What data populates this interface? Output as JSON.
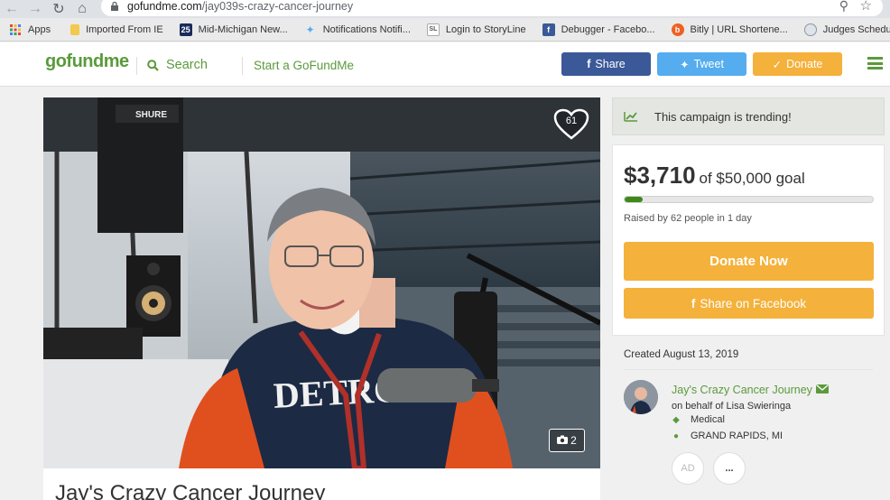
{
  "browser": {
    "url_host": "gofundme.com",
    "url_path": "/jay039s-crazy-cancer-journey",
    "bookmarks": [
      {
        "label": "Apps",
        "icon": "apps-grid-icon",
        "color": "#e8453c"
      },
      {
        "label": "Imported From IE",
        "icon": "folder-icon",
        "color": "#f2c94c"
      },
      {
        "label": "Mid-Michigan New...",
        "icon": "channel-25-icon",
        "color": "#1a2b5c"
      },
      {
        "label": "Notifications Notifi...",
        "icon": "twitter-bird-icon",
        "color": "#55acee"
      },
      {
        "label": "Login to StoryLine",
        "icon": "storyline-icon",
        "color": "#777777"
      },
      {
        "label": "Debugger - Facebo...",
        "icon": "facebook-icon",
        "color": "#3b5998"
      },
      {
        "label": "Bitly | URL Shortene...",
        "icon": "bitly-icon",
        "color": "#ee6123"
      },
      {
        "label": "Judges Schedule –...",
        "icon": "globe-icon",
        "color": "#8b95a5"
      }
    ]
  },
  "header": {
    "logo": "gofundme",
    "search_label": "Search",
    "start_label": "Start a GoFundMe",
    "share_label": "Share",
    "tweet_label": "Tweet",
    "donate_label": "Donate",
    "colors": {
      "brand": "#5b9a3c",
      "facebook": "#3b5998",
      "twitter": "#55acee",
      "donate": "#f4b13b"
    }
  },
  "campaign": {
    "title": "Jay's Crazy Cancer Journey",
    "hearts": "61",
    "photo_count": "2",
    "photo_text": "DETROIT"
  },
  "sidebar": {
    "trending_text": "This campaign is trending!",
    "amount_raised": "$3,710",
    "goal_text": "of $50,000 goal",
    "progress_fraction": 0.0742,
    "raised_by": "Raised by 62 people in 1 day",
    "donate_now_label": "Donate Now",
    "share_facebook_label": "Share on Facebook",
    "created": "Created August 13, 2019",
    "organizer_name": "Jay's Crazy Cancer Journey",
    "on_behalf": "on behalf of Lisa Swieringa",
    "category": "Medical",
    "location": "GRAND RAPIDS, MI",
    "avatar_initials": "AD",
    "more_label": "..."
  }
}
